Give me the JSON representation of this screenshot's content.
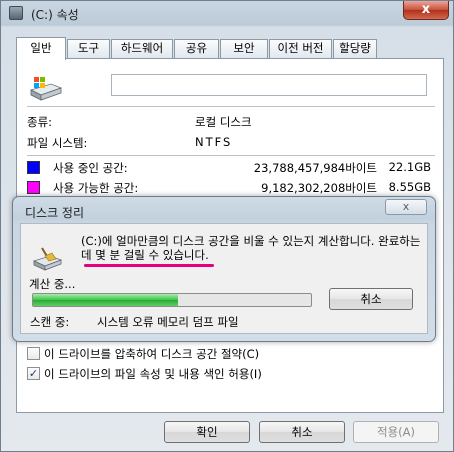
{
  "window": {
    "title": "(C:) 속성",
    "close_label": "x"
  },
  "tabs": [
    "일반",
    "도구",
    "하드웨어",
    "공유",
    "보안",
    "이전 버전",
    "할당량"
  ],
  "general": {
    "name_value": "",
    "type_label": "종류:",
    "type_value": "로컬 디스크",
    "fs_label": "파일 시스템:",
    "fs_value": "NTFS",
    "used_label": "사용 중인 공간:",
    "used_bytes": "23,788,457,984바이트",
    "used_gb": "22.1GB",
    "free_label": "사용 가능한 공간:",
    "free_bytes": "9,182,302,208바이트",
    "free_gb": "8.55GB",
    "used_color": "#0000ff",
    "free_color": "#ff00ff"
  },
  "options": {
    "compress_label": "이 드라이브를 압축하여 디스크 공간 절약(C)",
    "compress_checked": false,
    "index_label": "이 드라이브의 파일 속성 및 내용 색인 허용(I)",
    "index_checked": true
  },
  "buttons": {
    "ok": "확인",
    "cancel": "취소",
    "apply": "적용(A)"
  },
  "cleanup_dialog": {
    "title": "디스크 정리",
    "close_label": "x",
    "message": "(C:)에 얼마만큼의 디스크 공간을 비울 수 있는지 계산합니다. 완료하는 데 몇 분 걸릴 수 있습니다.",
    "calculating_label": "계산 중...",
    "progress_fraction": 0.52,
    "cancel_label": "취소",
    "scan_label": "스캔 중:",
    "scan_value": "시스템 오류 메모리 덤프 파일",
    "highlight_color": "#e6007e"
  }
}
